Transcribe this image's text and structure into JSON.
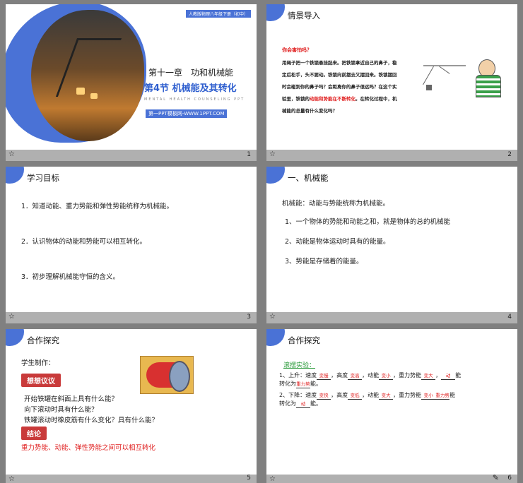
{
  "slides": [
    {
      "chapter": "第十一章　功和机械能",
      "section": "第4节  机械能及其转化",
      "subtitle": "MENTAL HEALTH COUNSELING PPT",
      "website": "第一PPT模板网-WWW.1PPT.COM",
      "edition_tag": "人教版物理八年级下册（初中）",
      "number": "1"
    },
    {
      "title": "情景导入",
      "question": "你会害怕吗？",
      "body": [
        "用绳子把一个铁锁悬挂起来。把铁锁拿近自己的鼻子，稳",
        "定后松手，头不要动。铁锁向前摆去又摆回来。铁锁摆回",
        "时会碰到你的鼻子吗？会距离你的鼻子很远吗？在这个实",
        "验里，铁锁的"
      ],
      "highlight": "动能和势能在不断转化",
      "body_tail": "。在转化过程中，机",
      "body_last": "械能的总量有什么变化吗？",
      "number": "2"
    },
    {
      "title": "学习目标",
      "items": [
        "1．知道动能、重力势能和弹性势能统称为机械能。",
        "2．认识物体的动能和势能可以相互转化。",
        "3．初步理解机械能守恒的含义。"
      ],
      "number": "3"
    },
    {
      "title": "一、机械能",
      "lead": "机械能：动能与势能统称为机械能。",
      "items": [
        "1、一个物体的势能和动能之和，就是物体的总的机械能",
        "2、动能是物体运动时具有的能量。",
        "3、势能是存储着的能量。"
      ],
      "number": "4"
    },
    {
      "title": "合作探究",
      "lead": "学生制作：",
      "badge1": "想想议议",
      "questions": [
        "开始铁罐在斜面上具有什么能？",
        "向下滚动时具有什么能？",
        "铁罐滚动时橡皮筋有什么变化？具有什么能？"
      ],
      "badge2": "结论",
      "conclusion": "重力势能、动能、弹性势能之间可以相互转化",
      "number": "5"
    },
    {
      "title": "合作探究",
      "experiment": "滚摆实验：",
      "up": {
        "p1": "1、上升：速度",
        "a1": "变慢",
        "p2": "，高度",
        "a2": "变高",
        "p3": "，动能",
        "a3": "变小",
        "p4": "，重力势能",
        "a4": "变大",
        "p5": "，",
        "a5": "动",
        "p6": "能",
        "p7": "转化为",
        "a6": "重力势",
        "p8": "能。"
      },
      "down": {
        "p1": "2、下降：速度",
        "a1": "变快",
        "p2": "，高度",
        "a2": "变低",
        "p3": "，动能",
        "a3": "变大",
        "p4": "，重力势能",
        "a4": "变小",
        "p5": "",
        "a5": "重力势",
        "p6": "能",
        "p7": "转化为",
        "a6": "动",
        "p8": "能。"
      },
      "number": "6"
    }
  ],
  "footer_star": "☆",
  "colors": {
    "accent": "#4a72d6",
    "badge": "#c93a3a",
    "highlight": "#e02020"
  }
}
